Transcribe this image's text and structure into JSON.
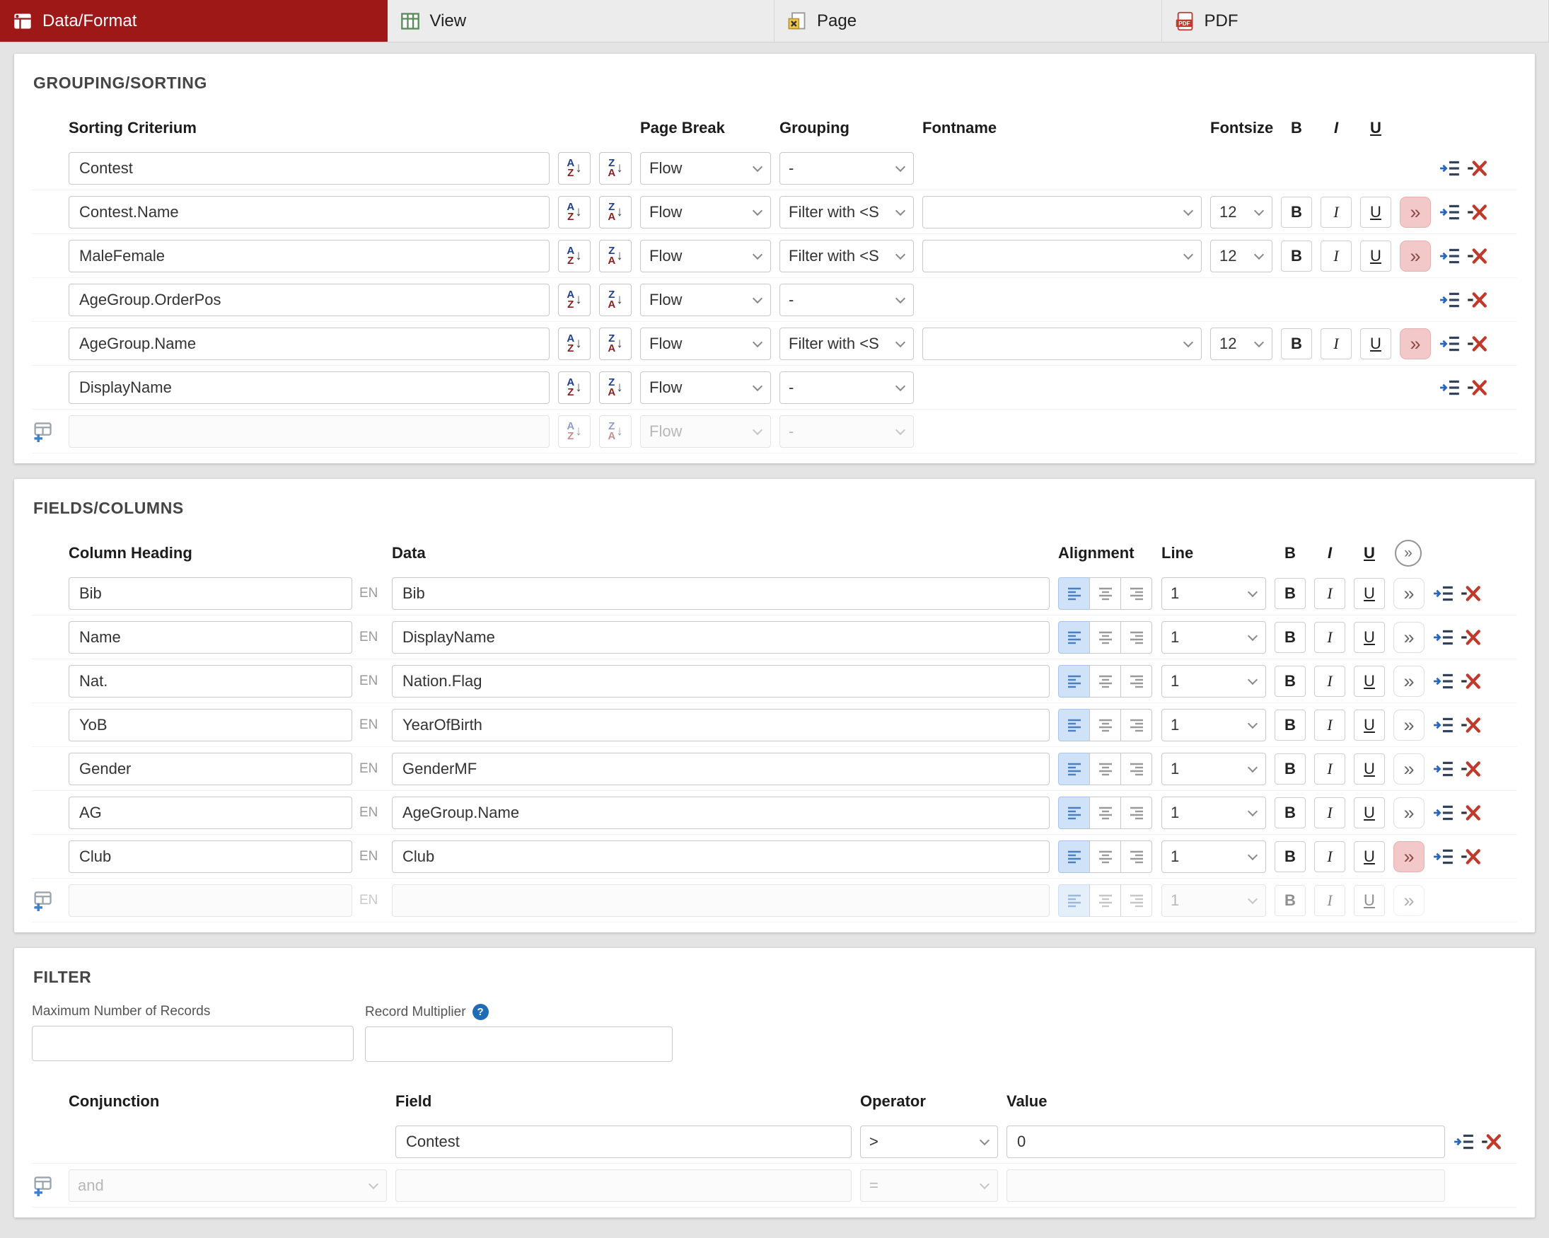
{
  "tabs": [
    {
      "label": "Data/Format",
      "active": true
    },
    {
      "label": "View",
      "active": false
    },
    {
      "label": "Page",
      "active": false
    },
    {
      "label": "PDF",
      "active": false
    }
  ],
  "icons": {
    "letter_a": "A",
    "letter_z": "Z",
    "arrow_down": "↓",
    "chevron_double": "»",
    "info_glyph": "?",
    "pdf_badge": "PDF"
  },
  "grouping_sorting": {
    "title": "GROUPING/SORTING",
    "headers": {
      "sorting_criterium": "Sorting Criterium",
      "page_break": "Page Break",
      "grouping": "Grouping",
      "fontname": "Fontname",
      "fontsize": "Fontsize",
      "bold": "B",
      "italic": "I",
      "underline": "U"
    },
    "rows": [
      {
        "criterium": "Contest",
        "page_break": "Flow",
        "grouping": "-",
        "fontname": "",
        "fontsize": "",
        "has_font": false,
        "chevron_highlight": false,
        "new_row": false
      },
      {
        "criterium": "Contest.Name",
        "page_break": "Flow",
        "grouping": "Filter with <S",
        "fontname": "",
        "fontsize": "12",
        "has_font": true,
        "chevron_highlight": true,
        "new_row": false
      },
      {
        "criterium": "MaleFemale",
        "page_break": "Flow",
        "grouping": "Filter with <S",
        "fontname": "",
        "fontsize": "12",
        "has_font": true,
        "chevron_highlight": true,
        "new_row": false
      },
      {
        "criterium": "AgeGroup.OrderPos",
        "page_break": "Flow",
        "grouping": "-",
        "fontname": "",
        "fontsize": "",
        "has_font": false,
        "chevron_highlight": false,
        "new_row": false
      },
      {
        "criterium": "AgeGroup.Name",
        "page_break": "Flow",
        "grouping": "Filter with <S",
        "fontname": "",
        "fontsize": "12",
        "has_font": true,
        "chevron_highlight": true,
        "new_row": false
      },
      {
        "criterium": "DisplayName",
        "page_break": "Flow",
        "grouping": "-",
        "fontname": "",
        "fontsize": "",
        "has_font": false,
        "chevron_highlight": false,
        "new_row": false
      },
      {
        "criterium": "",
        "page_break": "Flow",
        "grouping": "-",
        "fontname": "",
        "fontsize": "",
        "has_font": false,
        "chevron_highlight": false,
        "new_row": true
      }
    ]
  },
  "fields_columns": {
    "title": "FIELDS/COLUMNS",
    "lang_badge": "EN",
    "headers": {
      "column_heading": "Column Heading",
      "data": "Data",
      "alignment": "Alignment",
      "line": "Line",
      "bold": "B",
      "italic": "I",
      "underline": "U"
    },
    "rows": [
      {
        "heading": "Bib",
        "data": "Bib",
        "line": "1",
        "chevron_highlight": false,
        "new_row": false
      },
      {
        "heading": "Name",
        "data": "DisplayName",
        "line": "1",
        "chevron_highlight": false,
        "new_row": false
      },
      {
        "heading": "Nat.",
        "data": "Nation.Flag",
        "line": "1",
        "chevron_highlight": false,
        "new_row": false
      },
      {
        "heading": "YoB",
        "data": "YearOfBirth",
        "line": "1",
        "chevron_highlight": false,
        "new_row": false
      },
      {
        "heading": "Gender",
        "data": "GenderMF",
        "line": "1",
        "chevron_highlight": false,
        "new_row": false
      },
      {
        "heading": "AG",
        "data": "AgeGroup.Name",
        "line": "1",
        "chevron_highlight": false,
        "new_row": false
      },
      {
        "heading": "Club",
        "data": "Club",
        "line": "1",
        "chevron_highlight": true,
        "new_row": false
      },
      {
        "heading": "",
        "data": "",
        "line": "1",
        "chevron_highlight": false,
        "new_row": true
      }
    ]
  },
  "filter": {
    "title": "FILTER",
    "max_records_label": "Maximum Number of Records",
    "max_records_value": "",
    "record_multiplier_label": "Record Multiplier",
    "record_multiplier_value": "",
    "headers": {
      "conjunction": "Conjunction",
      "field": "Field",
      "operator": "Operator",
      "value": "Value"
    },
    "rows": [
      {
        "conjunction": "",
        "field": "Contest",
        "operator": ">",
        "value": "0",
        "hide_conjunction": true,
        "new_row": false
      },
      {
        "conjunction": "and",
        "field": "",
        "operator": "=",
        "value": "",
        "hide_conjunction": false,
        "new_row": true
      }
    ]
  }
}
